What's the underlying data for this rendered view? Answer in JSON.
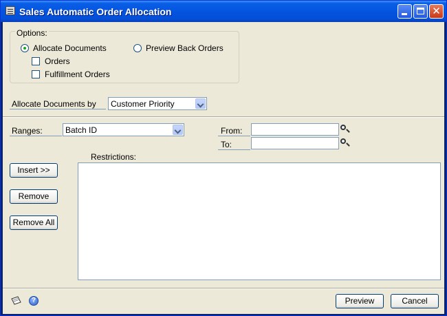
{
  "window": {
    "title": "Sales Automatic Order Allocation",
    "close_glyph": "✕"
  },
  "options": {
    "legend": "Options:",
    "allocate_documents": "Allocate Documents",
    "preview_back_orders": "Preview Back Orders",
    "orders": "Orders",
    "fulfillment_orders": "Fulfillment Orders",
    "selected": "allocate_documents"
  },
  "allocate_by": {
    "label": "Allocate Documents by",
    "value": "Customer Priority"
  },
  "ranges": {
    "label": "Ranges:",
    "value": "Batch ID",
    "from_label": "From:",
    "to_label": "To:",
    "from_value": "",
    "to_value": ""
  },
  "restrictions": {
    "label": "Restrictions:"
  },
  "buttons": {
    "insert": "Insert >>",
    "remove": "Remove",
    "remove_all": "Remove All",
    "preview": "Preview",
    "cancel": "Cancel"
  },
  "footer": {
    "help_glyph": "?"
  },
  "icons": {
    "app": "window-app-icon",
    "minimize": "minimize-icon",
    "maximize": "maximize-icon",
    "close": "close-icon",
    "lookup": "magnifier-icon",
    "note": "note-icon",
    "help": "help-icon"
  }
}
